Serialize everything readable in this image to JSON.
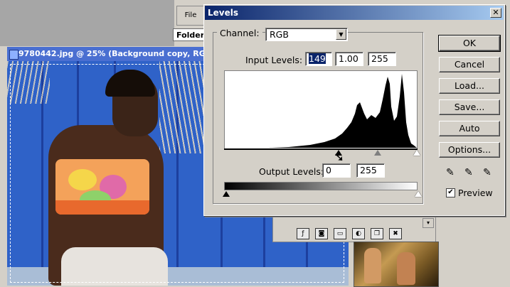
{
  "app": {
    "menu_file": "File",
    "folder_tab": "Folder",
    "document_title": "9780442.jpg @ 25% (Background copy, RG"
  },
  "layers_palette": {
    "tools": [
      "circle-half-icon",
      "mask-icon",
      "folder-icon",
      "adjustment-icon",
      "new-layer-icon",
      "trash-icon"
    ]
  },
  "levels": {
    "title": "Levels",
    "close_label": "✕",
    "channel_label": "Channel:",
    "channel_value": "RGB",
    "input_label": "Input Levels:",
    "input_black": "149",
    "input_gamma": "1.00",
    "input_white": "255",
    "output_label": "Output Levels:",
    "output_black": "0",
    "output_white": "255",
    "buttons": {
      "ok": "OK",
      "cancel": "Cancel",
      "load": "Load...",
      "save": "Save...",
      "auto": "Auto",
      "options": "Options..."
    },
    "preview_label": "Preview",
    "preview_checked": true
  }
}
